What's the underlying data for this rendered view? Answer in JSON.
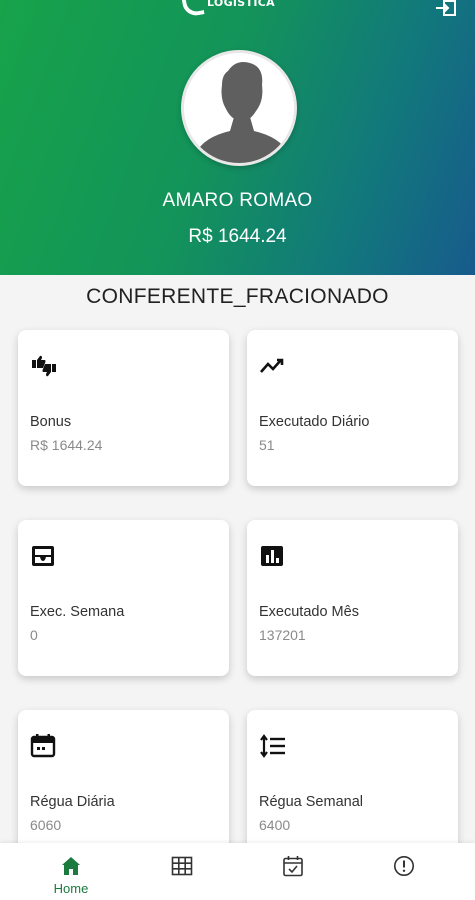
{
  "header": {
    "logo_text": "LOGÍSTICA",
    "user_name": "AMARO ROMAO",
    "balance": "R$ 1644.24",
    "gradient_colors": [
      "#17a34a",
      "#175b8c"
    ]
  },
  "role": "CONFERENTE_FRACIONADO",
  "cards": [
    {
      "icon": "thumbs-up-down-icon",
      "label": "Bonus",
      "value": "R$ 1644.24"
    },
    {
      "icon": "trending-up-icon",
      "label": "Executado Diário",
      "value": "51"
    },
    {
      "icon": "inbox-icon",
      "label": "Exec. Semana",
      "value": "0"
    },
    {
      "icon": "bar-chart-icon",
      "label": "Executado Mês",
      "value": "137201"
    },
    {
      "icon": "calendar-icon",
      "label": "Régua Diária",
      "value": "6060"
    },
    {
      "icon": "sort-lines-icon",
      "label": "Régua Semanal",
      "value": "6400"
    }
  ],
  "bottom_nav": {
    "items": [
      {
        "icon": "home-icon",
        "label": "Home",
        "active": true
      },
      {
        "icon": "grid-icon",
        "label": "",
        "active": false
      },
      {
        "icon": "calendar-check-icon",
        "label": "",
        "active": false
      },
      {
        "icon": "info-icon",
        "label": "",
        "active": false
      }
    ],
    "active_color": "#1b7a3e"
  }
}
